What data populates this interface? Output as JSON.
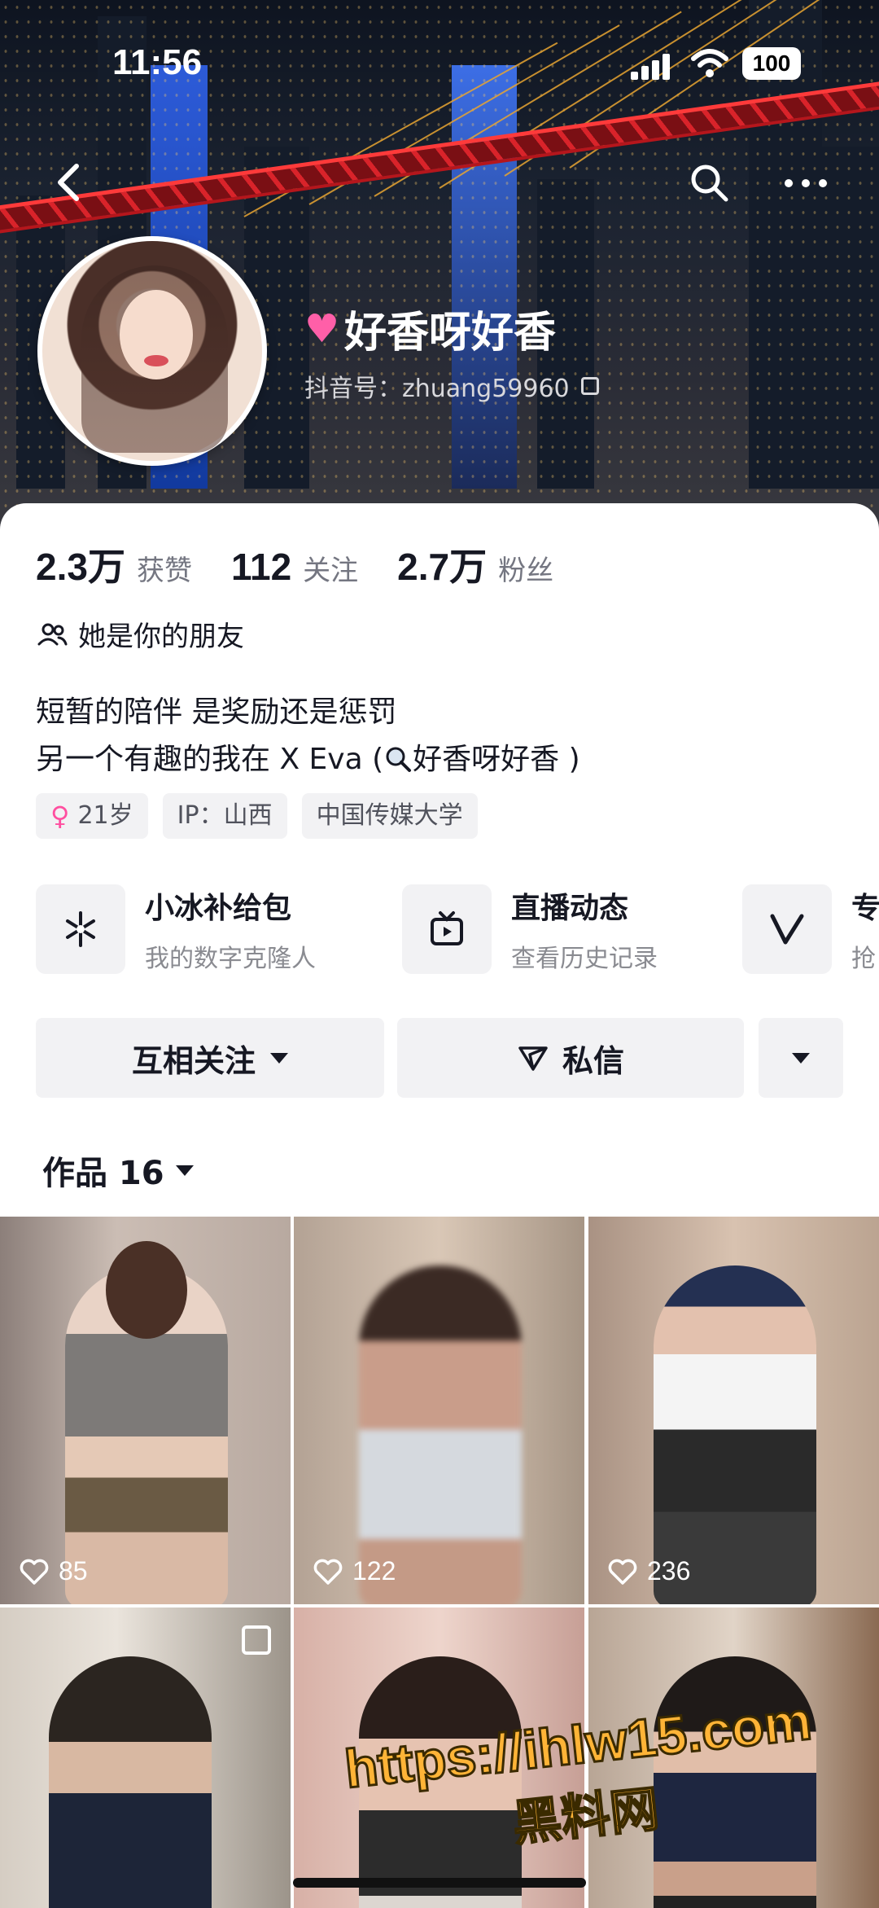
{
  "status_bar": {
    "time": "11:56",
    "battery": "100"
  },
  "profile": {
    "nickname": "好香呀好香",
    "douyin_id": "抖音号：zhuang59960"
  },
  "stats": [
    {
      "value": "2.3万",
      "label": "获赞"
    },
    {
      "value": "112",
      "label": "关注"
    },
    {
      "value": "2.7万",
      "label": "粉丝"
    }
  ],
  "relation": "她是你的朋友",
  "bio": {
    "line1": "短暂的陪伴 是奖励还是惩罚",
    "line2_prefix": "另一个有趣的我在 X Eva (",
    "line2_link": "好香呀好香",
    "line2_suffix": " )"
  },
  "tags": {
    "age": "21岁",
    "ip": "IP：山西",
    "school": "中国传媒大学"
  },
  "services": [
    {
      "title": "小冰补给包",
      "subtitle": "我的数字克隆人",
      "icon": "sparkle-icon"
    },
    {
      "title": "直播动态",
      "subtitle": "查看历史记录",
      "icon": "tv-icon"
    },
    {
      "title": "专",
      "subtitle": "抢",
      "icon": "v-icon"
    }
  ],
  "actions": {
    "follow": "互相关注",
    "message": "私信"
  },
  "works": {
    "label": "作品 16"
  },
  "videos": [
    {
      "likes": "85"
    },
    {
      "likes": "122"
    },
    {
      "likes": "236"
    },
    {
      "likes": ""
    },
    {
      "likes": ""
    },
    {
      "likes": ""
    }
  ],
  "watermark": {
    "url": "https://ihlw15.com",
    "name": "黑料网"
  },
  "colors": {
    "accent_pink": "#ff5fa8",
    "bridge_red": "#d9232a",
    "text_primary": "#161823",
    "text_secondary": "#747681",
    "chip_bg": "#f2f2f4"
  }
}
